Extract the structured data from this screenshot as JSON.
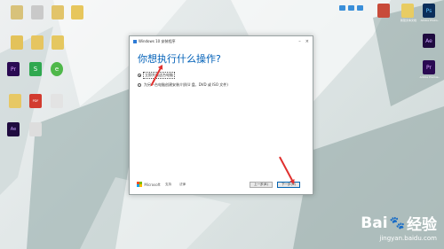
{
  "dialog": {
    "title": "Windows 10 安装程序",
    "heading": "你想执行什么操作?",
    "options": [
      {
        "label": "立即升级这台电脑",
        "checked": true
      },
      {
        "label": "为另一台电脑创建安装介质(U 盘、DVD 或 ISO 文件)",
        "checked": false
      }
    ],
    "footer": {
      "brand": "Microsoft",
      "links": [
        "支持",
        "法律"
      ],
      "back_label": "上一步(B)",
      "next_label": "下一步(N)"
    }
  },
  "desktop": {
    "icons_left": [
      "Pr",
      "S",
      "e",
      "PDF",
      "Ae"
    ],
    "icons_right": [
      "Ps",
      "Ae",
      "Pr"
    ],
    "right_labels": [
      "新建文本文档",
      "Adobe Photo..",
      "Adobe Premie.."
    ]
  },
  "watermark": {
    "brand": "Bai",
    "brand2": "经验",
    "url": "jingyan.baidu.com"
  },
  "colors": {
    "accent": "#0060b8",
    "arrow": "#e0312f",
    "ps": "#0b2e5a",
    "pr": "#2a0a52",
    "ae": "#1f0b3f"
  }
}
